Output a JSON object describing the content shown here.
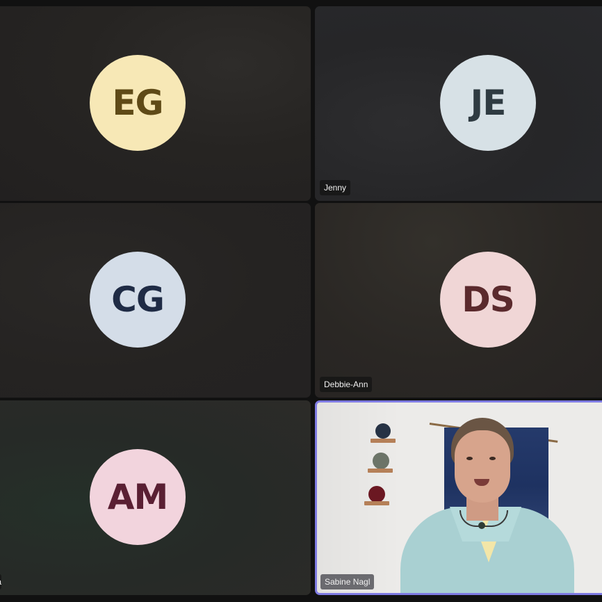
{
  "meeting": {
    "participants": [
      {
        "initials": "EG",
        "name": "",
        "avatar_bg": "#f7e8b6",
        "avatar_fg": "#5f4a17"
      },
      {
        "initials": "JE",
        "name": "Jenny",
        "avatar_bg": "#d7e1e6",
        "avatar_fg": "#2f3b42"
      },
      {
        "initials": "CG",
        "name": "",
        "avatar_bg": "#d4dde8",
        "avatar_fg": "#1f2b45"
      },
      {
        "initials": "DS",
        "name": "Debbie-Ann",
        "avatar_bg": "#f0d6d6",
        "avatar_fg": "#5b2a2d"
      },
      {
        "initials": "AM",
        "name": "ka",
        "avatar_bg": "#f2d4dd",
        "avatar_fg": "#5a1f33"
      },
      {
        "initials": "",
        "name": "Sabine Nagl",
        "video": true,
        "active_speaker": true
      }
    ],
    "colors": {
      "active_speaker_border": "#7f7be3"
    }
  }
}
